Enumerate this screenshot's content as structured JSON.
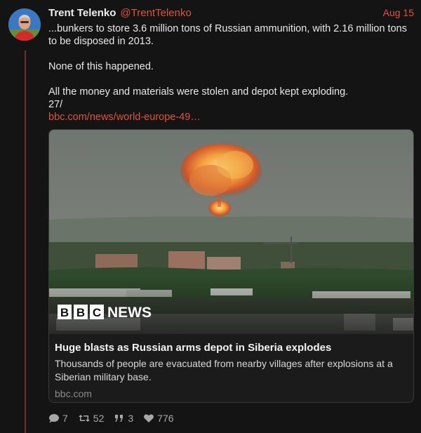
{
  "tweet": {
    "author_name": "Trent Telenko",
    "author_handle": "@TrentTelenko",
    "date": "Aug 15",
    "lines": [
      "...bunkers to store 3.6 million tons of Russian ammunition, with 2.16 million tons to be disposed in 2013.",
      "None of this happened.",
      "All the money and materials were stolen and depot kept exploding.",
      "27/"
    ],
    "link_text": "bbc.com/news/world-europe-49…"
  },
  "card": {
    "logo_letters": [
      "B",
      "B",
      "C"
    ],
    "logo_word": "NEWS",
    "title": "Huge blasts as Russian arms depot in Siberia explodes",
    "description": "Thousands of people are evacuated from nearby villages after explosions at a Siberian military base.",
    "domain": "bbc.com"
  },
  "actions": {
    "replies": "7",
    "retweets": "52",
    "quotes": "3",
    "likes": "776"
  },
  "colors": {
    "accent": "#e0533c",
    "thread_line": "#7a2b2b",
    "background": "#141414"
  },
  "icons": [
    "reply-icon",
    "retweet-icon",
    "quote-icon",
    "heart-icon"
  ]
}
